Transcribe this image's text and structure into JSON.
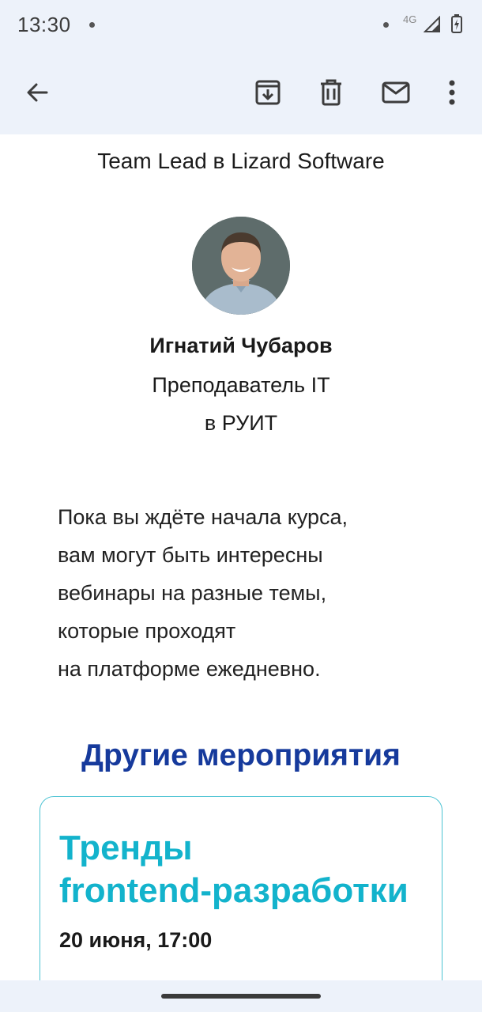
{
  "status_bar": {
    "time": "13:30",
    "network": "4G"
  },
  "toolbar": {
    "back_icon": "arrow-left-icon",
    "archive_icon": "archive-icon",
    "delete_icon": "trash-icon",
    "mail_icon": "mail-icon",
    "more_icon": "more-vert-icon"
  },
  "email": {
    "sender_subtitle": "Team Lead в Lizard Software",
    "teacher": {
      "name": "Игнатий Чубаров",
      "role": "Преподаватель IT",
      "org": "в РУИТ"
    },
    "intro_lines": [
      "Пока вы ждёте начала курса,",
      "вам могут быть интересны",
      "вебинары на разные темы,",
      "которые проходят",
      "на платформе ежедневно."
    ],
    "section_title": "Другие мероприятия",
    "event": {
      "title_lines": [
        "Тренды",
        "frontend-разработки"
      ],
      "date": "20 июня, 17:00"
    }
  },
  "colors": {
    "bar_background": "#edf2fa",
    "section_title": "#163a9c",
    "event_accent": "#13b3cc",
    "card_border": "#4cc3d3"
  }
}
